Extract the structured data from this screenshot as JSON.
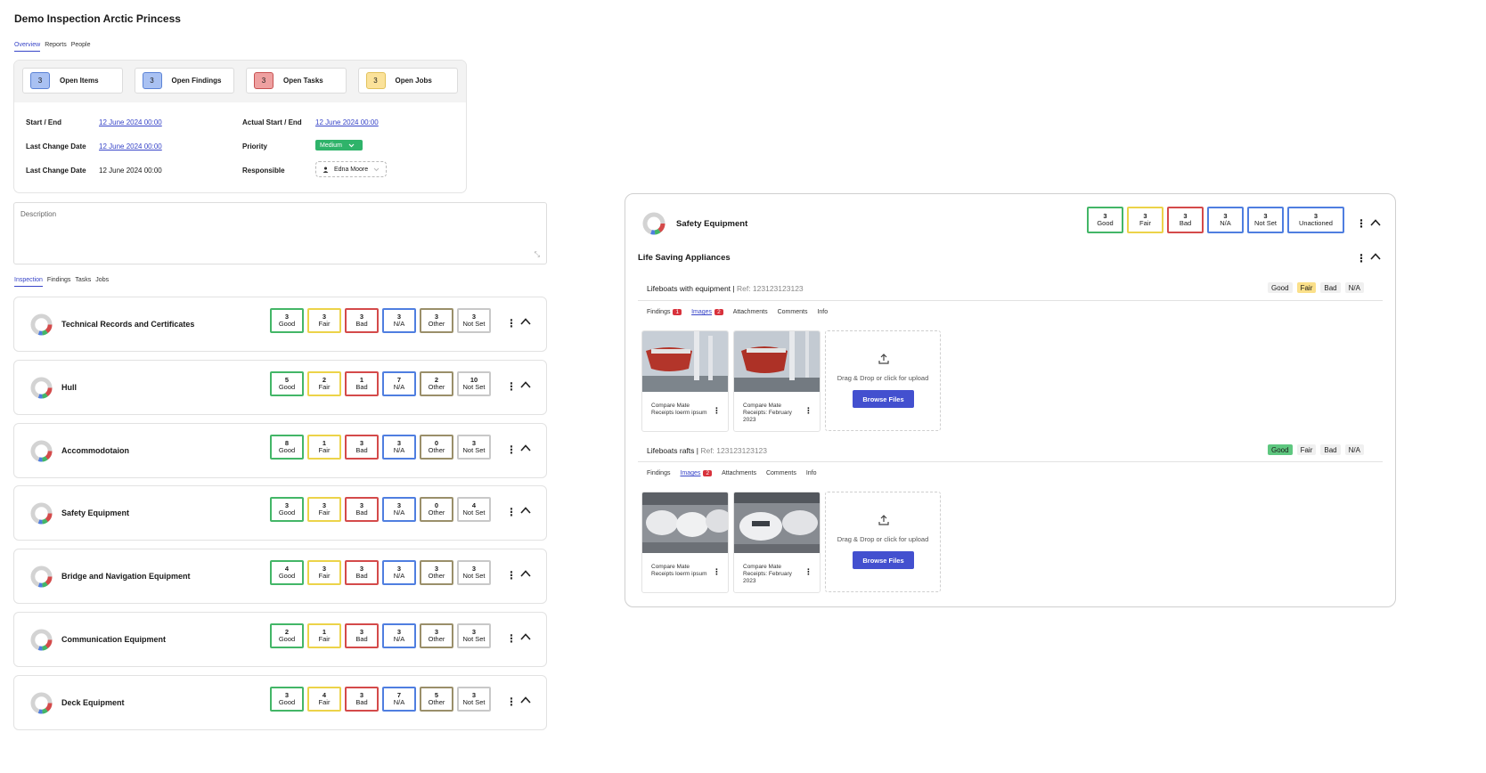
{
  "page_title": "Demo Inspection Arctic Princess",
  "main_tabs": [
    "Overview",
    "Reports",
    "People"
  ],
  "summary": [
    {
      "count": "3",
      "label": "Open Items"
    },
    {
      "count": "3",
      "label": "Open Findings"
    },
    {
      "count": "3",
      "label": "Open Tasks"
    },
    {
      "count": "3",
      "label": "Open Jobs"
    }
  ],
  "fields": {
    "start_end_label": "Start / End",
    "start_end_value": "12 June  2024 00:00",
    "actual_label": "Actual Start / End",
    "actual_value": "12 June  2024 00:00",
    "last_change_label": "Last Change Date",
    "last_change_value": "12 June  2024 00:00",
    "priority_label": "Priority",
    "priority_value": "Medium",
    "last_change2_label": "Last Change Date",
    "last_change2_value": "12 June 2024 00:00",
    "responsible_label": "Responsible",
    "responsible_value": "Edna Moore"
  },
  "description_label": "Description",
  "sub_tabs": [
    "Inspection",
    "Findings",
    "Tasks",
    "Jobs"
  ],
  "status_labels": [
    "Good",
    "Fair",
    "Bad",
    "N/A",
    "Other",
    "Not Set"
  ],
  "sections": [
    {
      "title": "Technical Records and Certificates",
      "counts": [
        "3",
        "3",
        "3",
        "3",
        "3",
        "3"
      ]
    },
    {
      "title": "Hull",
      "counts": [
        "5",
        "2",
        "1",
        "7",
        "2",
        "10"
      ]
    },
    {
      "title": "Accommodotaion",
      "counts": [
        "8",
        "1",
        "3",
        "3",
        "0",
        "3"
      ]
    },
    {
      "title": "Safety Equipment",
      "counts": [
        "3",
        "3",
        "3",
        "3",
        "0",
        "4"
      ]
    },
    {
      "title": "Bridge and Navigation Equipment",
      "counts": [
        "4",
        "3",
        "3",
        "3",
        "3",
        "3"
      ]
    },
    {
      "title": "Communication Equipment",
      "counts": [
        "2",
        "1",
        "3",
        "3",
        "3",
        "3"
      ]
    },
    {
      "title": "Deck Equipment",
      "counts": [
        "3",
        "4",
        "3",
        "7",
        "5",
        "3"
      ]
    }
  ],
  "detail": {
    "title": "Safety Equipment",
    "status": [
      {
        "num": "3",
        "label": "Good"
      },
      {
        "num": "3",
        "label": "Fair"
      },
      {
        "num": "3",
        "label": "Bad"
      },
      {
        "num": "3",
        "label": "N/A"
      },
      {
        "num": "3",
        "label": "Not Set"
      },
      {
        "num": "3",
        "label": "Unactioned"
      }
    ],
    "subsection": "Life Saving Appliances",
    "ratings": [
      "Good",
      "Fair",
      "Bad",
      "N/A"
    ],
    "items": [
      {
        "name": "Lifeboats with equipment",
        "sep": " | ",
        "ref": "Ref: 123123123123",
        "selected": "Fair",
        "tabs": {
          "findings": "Findings",
          "findings_count": "1",
          "images": "Images",
          "images_count": "2",
          "attachments": "Attachments",
          "comments": "Comments",
          "info": "Info"
        },
        "images": [
          {
            "caption": "Compare Mate Receipts loerm ipsum"
          },
          {
            "caption": "Compare Mate Receipts: February 2023"
          }
        ]
      },
      {
        "name": "Lifeboats rafts",
        "sep": " | ",
        "ref": "Ref: 123123123123",
        "selected": "Good",
        "tabs": {
          "findings": "Findings",
          "images": "Images",
          "images_count": "2",
          "attachments": "Attachments",
          "comments": "Comments",
          "info": "Info"
        },
        "images": [
          {
            "caption": "Compare Mate Receipts loerm ipsum"
          },
          {
            "caption": "Compare Mate Receipts: February 2023"
          }
        ]
      }
    ],
    "upload_text": "Drag & Drop or click for upload",
    "browse_label": "Browse Files"
  },
  "colors": {
    "accent": "#3845c8",
    "good": "#43b667",
    "fair": "#ecd349",
    "bad": "#d44a4a",
    "na": "#4f7ee0",
    "button": "#4350cf"
  }
}
